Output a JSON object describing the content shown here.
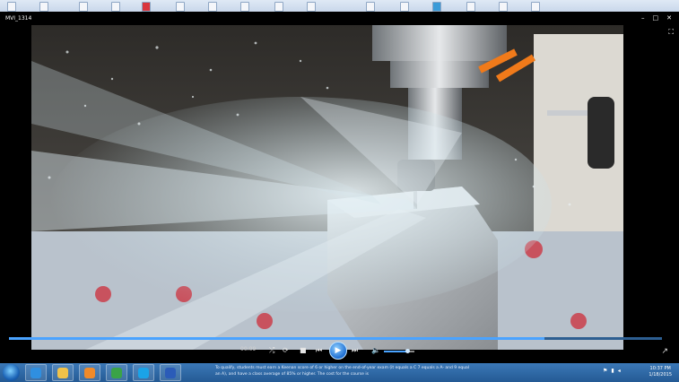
{
  "window": {
    "title": "MVI_1314",
    "controls": {
      "minimize": "–",
      "maximize": "□",
      "close": "✕"
    }
  },
  "player": {
    "time_elapsed": "00:09",
    "progress_fraction": 0.82,
    "volume_fraction": 0.75,
    "buttons": {
      "shuffle": "⤮",
      "repeat": "⟳",
      "stop": "■",
      "previous": "⏮",
      "play": "▶",
      "next": "⏭",
      "volume": "🔈",
      "fullscreen": "⛶",
      "switch_view": "↗"
    }
  },
  "taskbar": {
    "notification_text": "To qualify, students must earn a Keenan score of 6 or higher on the end-of-year exam (it equals a C 7 equals a A- and 9 equal an A), and have a class average of 85% or higher. The cost for the course is",
    "apps": [
      {
        "name": "internet-explorer",
        "color": "#2f8fe0"
      },
      {
        "name": "file-explorer",
        "color": "#f0c24a"
      },
      {
        "name": "media-player",
        "color": "#f08a2a"
      },
      {
        "name": "chrome",
        "color": "#3aa348"
      },
      {
        "name": "skype",
        "color": "#1aa3e8"
      },
      {
        "name": "word",
        "color": "#2b5cb8"
      }
    ],
    "clock_time": "10:37 PM",
    "clock_date": "1/18/2015"
  }
}
